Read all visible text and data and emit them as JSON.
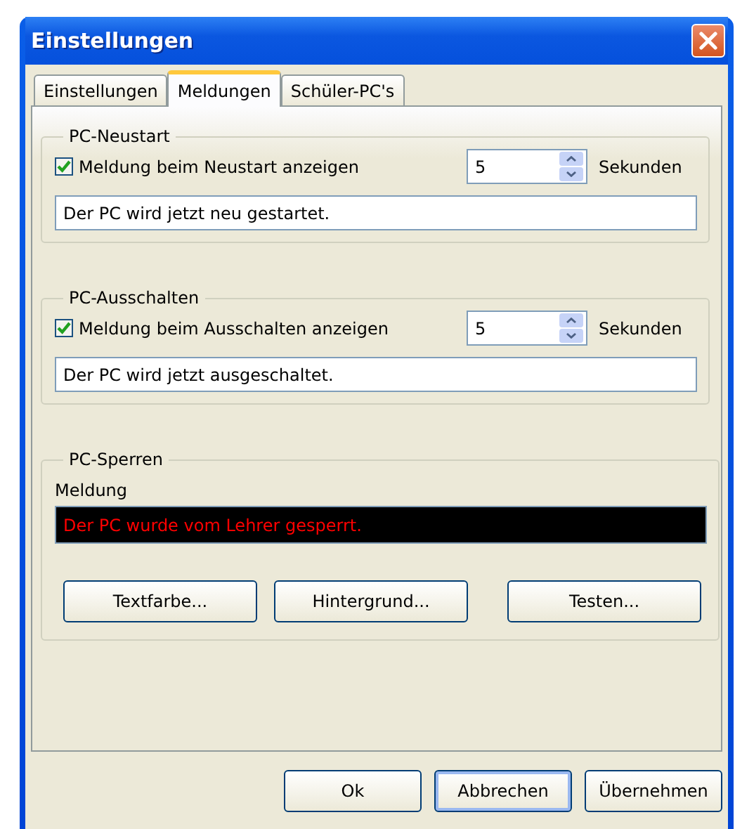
{
  "window": {
    "title": "Einstellungen"
  },
  "tabs": [
    {
      "label": "Einstellungen",
      "selected": false
    },
    {
      "label": "Meldungen",
      "selected": true
    },
    {
      "label": "Schüler-PC's",
      "selected": false
    }
  ],
  "groups": [
    {
      "kind": "timed",
      "title": "PC-Neustart",
      "checkbox": {
        "label": "Meldung beim Neustart anzeigen",
        "checked": true
      },
      "spinner": {
        "value": "5",
        "unit": "Sekunden"
      },
      "message": "Der PC wird jetzt neu gestartet."
    },
    {
      "kind": "timed",
      "title": "PC-Ausschalten",
      "checkbox": {
        "label": "Meldung beim Ausschalten anzeigen",
        "checked": true
      },
      "spinner": {
        "value": "5",
        "unit": "Sekunden"
      },
      "message": "Der PC wird jetzt ausgeschaltet."
    },
    {
      "kind": "lock",
      "title": "PC-Sperren",
      "message_label": "Meldung",
      "message": "Der PC wurde vom Lehrer gesperrt.",
      "buttons": [
        "Textfarbe...",
        "Hintergrund...",
        "Testen..."
      ]
    }
  ],
  "buttons": [
    {
      "label": "Ok",
      "focused": false
    },
    {
      "label": "Abbrechen",
      "focused": true
    },
    {
      "label": "Übernehmen",
      "focused": false
    }
  ]
}
